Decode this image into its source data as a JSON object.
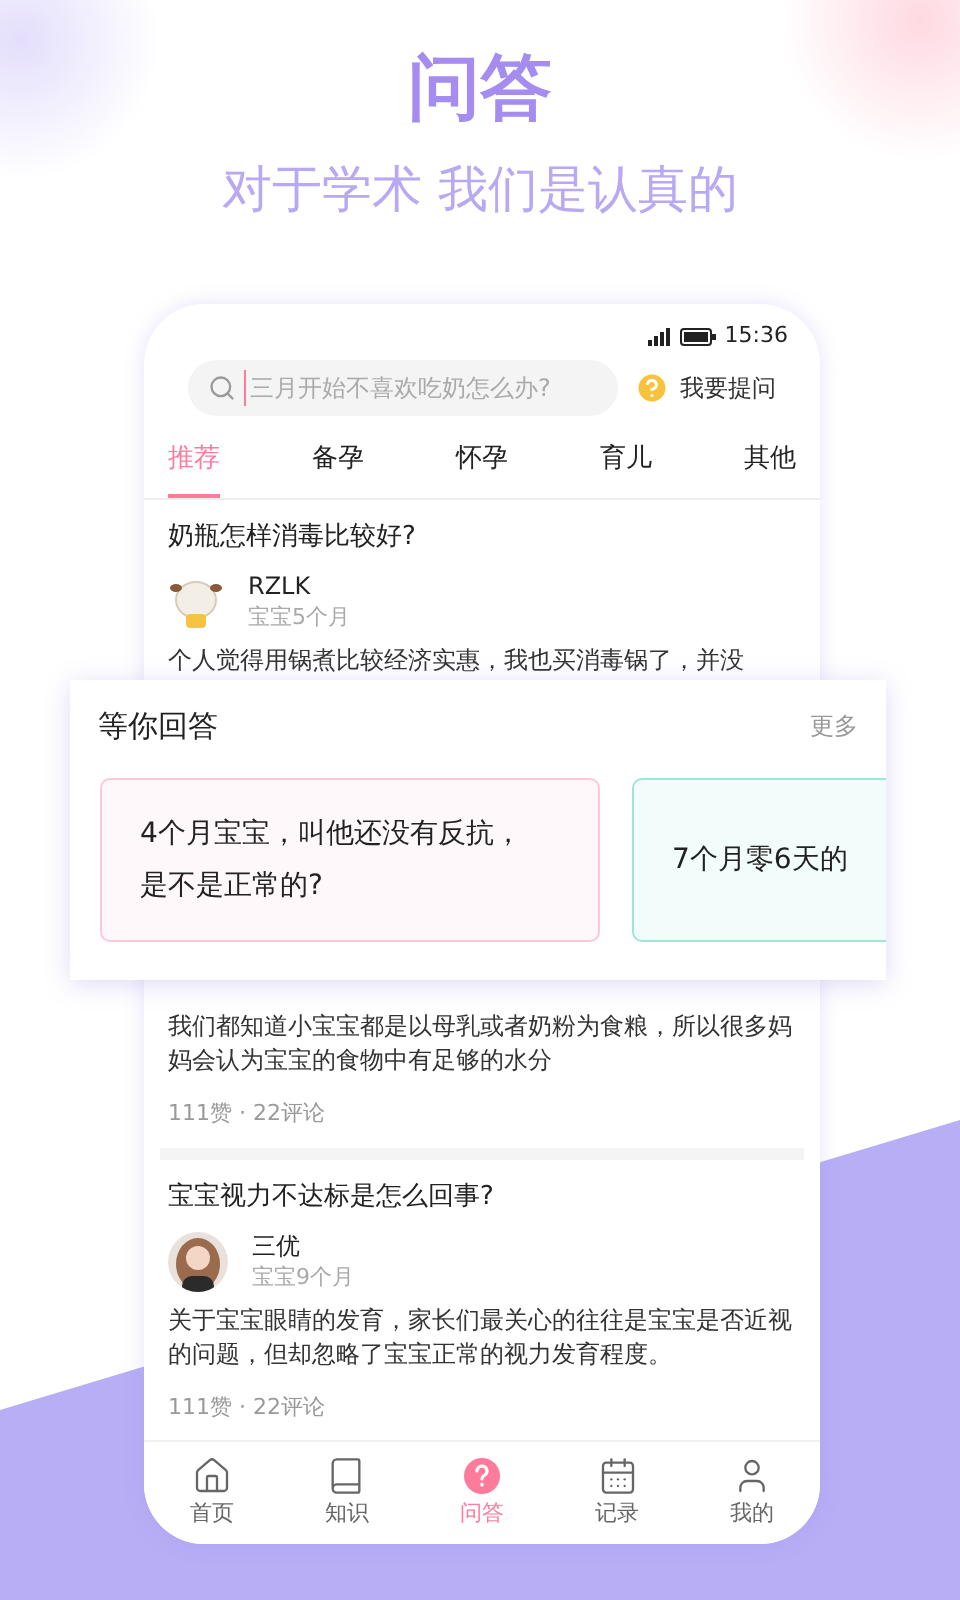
{
  "header": {
    "title": "问答",
    "subtitle": "对于学术 我们是认真的"
  },
  "status_bar": {
    "time": "15:36"
  },
  "search": {
    "placeholder": "三月开始不喜欢吃奶怎么办?"
  },
  "ask_button": {
    "label": "我要提问"
  },
  "tabs": [
    {
      "label": "推荐",
      "selected": true
    },
    {
      "label": "备孕",
      "selected": false
    },
    {
      "label": "怀孕",
      "selected": false
    },
    {
      "label": "育儿",
      "selected": false
    },
    {
      "label": "其他",
      "selected": false
    }
  ],
  "posts": [
    {
      "title": "奶瓶怎样消毒比较好?",
      "author": {
        "name": "RZLK",
        "baby_age": "宝宝5个月",
        "kind": "cartoon"
      },
      "body": "个人觉得用锅煮比较经济实惠，我也买消毒锅了，并没"
    },
    {
      "body": "我们都知道小宝宝都是以母乳或者奶粉为食粮，所以很多妈妈会认为宝宝的食物中有足够的水分",
      "stats": "111赞 · 22评论"
    },
    {
      "title": "宝宝视力不达标是怎么回事?",
      "author": {
        "name": "三优",
        "baby_age": "宝宝9个月",
        "kind": "person"
      },
      "body": "关于宝宝眼睛的发育，家长们最关心的往往是宝宝是否近视的问题，但却忽略了宝宝正常的视力发育程度。",
      "stats": "111赞 · 22评论"
    }
  ],
  "waiting": {
    "title": "等你回答",
    "more": "更多",
    "cards": [
      {
        "text": "4个月宝宝，叫他还没有反抗，是不是正常的?",
        "color": "#ffc8d6"
      },
      {
        "text": "7个月零6天的",
        "color": "#9ee6d8"
      }
    ]
  },
  "nav": [
    {
      "label": "首页",
      "selected": false
    },
    {
      "label": "知识",
      "selected": false
    },
    {
      "label": "问答",
      "selected": true
    },
    {
      "label": "记录",
      "selected": false
    },
    {
      "label": "我的",
      "selected": false
    }
  ]
}
